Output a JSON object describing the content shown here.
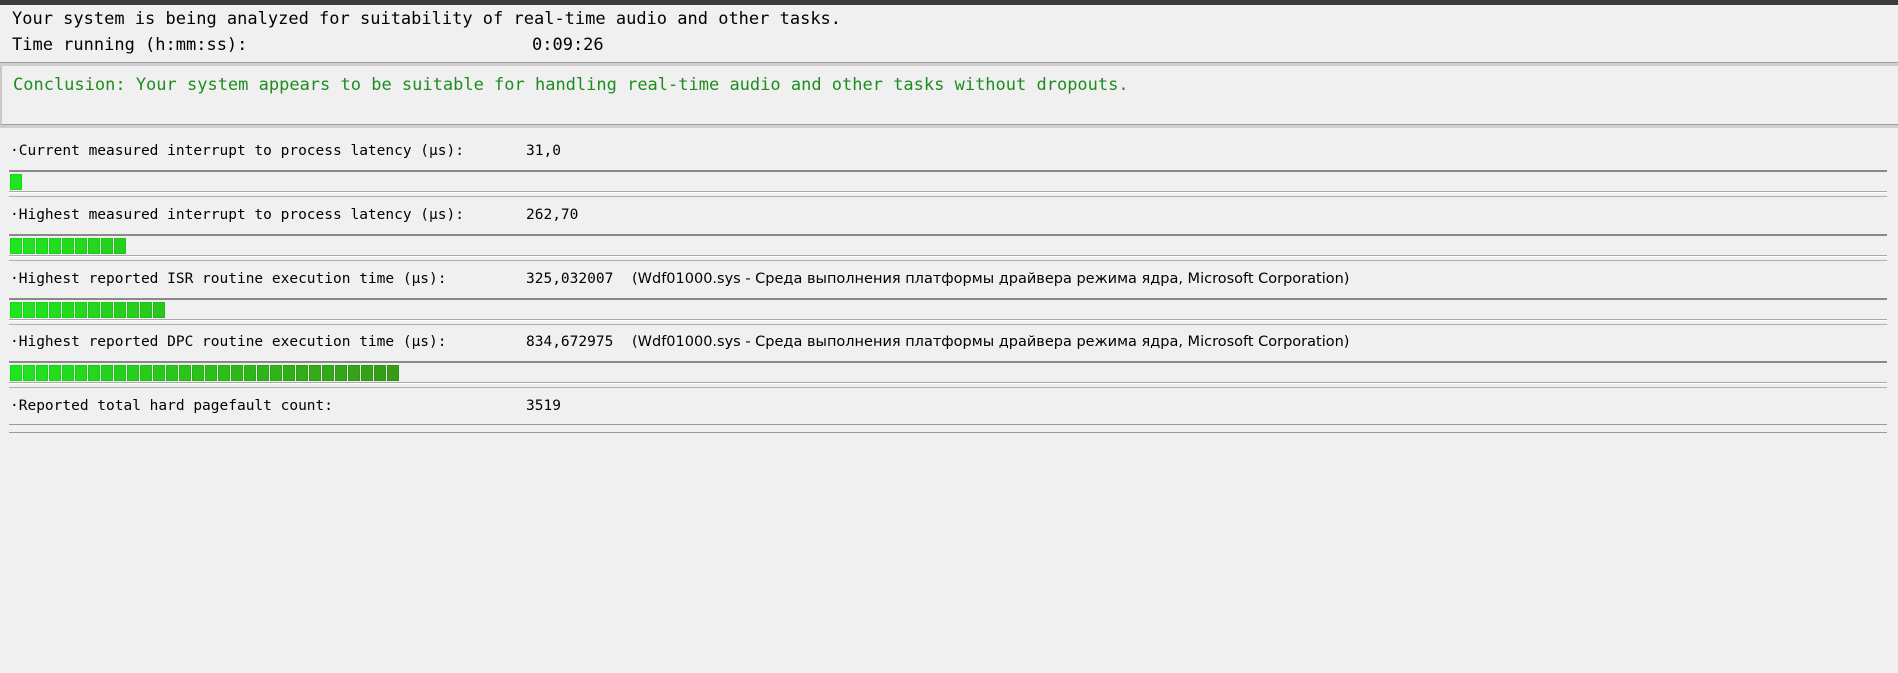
{
  "status": {
    "analyzing_text": "Your system is being analyzed for suitability of real-time audio and other tasks.",
    "time_label": "Time running (h:mm:ss):",
    "time_value": "0:09:26"
  },
  "conclusion": {
    "text": "Conclusion: Your system appears to be suitable for handling real-time audio and other tasks without dropouts."
  },
  "metrics": [
    {
      "label": "·Current measured interrupt to process latency (µs):",
      "value": "31,0",
      "note": "",
      "meter_segments": 1
    },
    {
      "label": "·Highest measured interrupt to process latency (µs):",
      "value": "262,70",
      "note": "",
      "meter_segments": 9
    },
    {
      "label": "·Highest reported ISR routine execution time (µs):",
      "value": "325,032007",
      "note": "(Wdf01000.sys - Среда выполнения платформы драйвера режима ядра, Microsoft Corporation)",
      "meter_segments": 12
    },
    {
      "label": "·Highest reported DPC routine execution time (µs):",
      "value": "834,672975",
      "note": "(Wdf01000.sys - Среда выполнения платформы драйвера режима ядра, Microsoft Corporation)",
      "meter_segments": 30
    },
    {
      "label": "·Reported total hard pagefault count:",
      "value": "3519",
      "note": "",
      "meter_segments": 0
    }
  ],
  "colors": {
    "meter_green_bright": "#1ee61e",
    "meter_green_dark": "#3c8c14",
    "conclusion_green": "#1e8c1e"
  }
}
